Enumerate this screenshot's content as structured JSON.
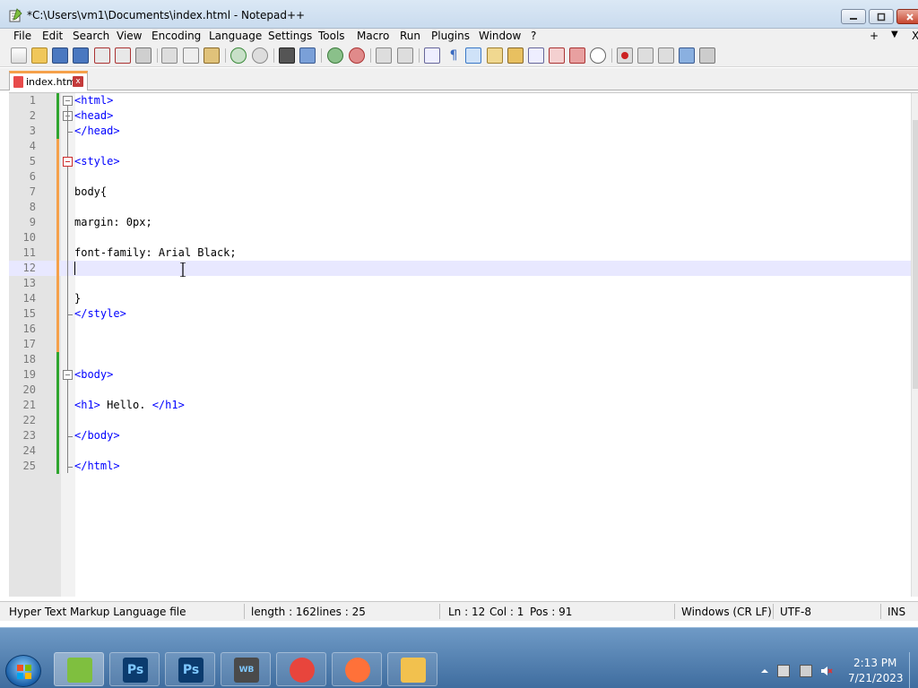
{
  "window": {
    "title": "*C:\\Users\\vm1\\Documents\\index.html - Notepad++"
  },
  "menu": {
    "items": [
      "File",
      "Edit",
      "Search",
      "View",
      "Encoding",
      "Language",
      "Settings",
      "Tools",
      "Macro",
      "Run",
      "Plugins",
      "Window",
      "?"
    ],
    "right_plus": "+",
    "right_down": "▼",
    "right_close": "X"
  },
  "toolbar": {
    "icons": [
      "new-file-icon",
      "open-file-icon",
      "save-icon",
      "save-all-icon",
      "close-icon",
      "close-all-icon",
      "print-icon",
      "cut-icon",
      "copy-icon",
      "paste-icon",
      "undo-icon",
      "redo-icon",
      "find-icon",
      "replace-icon",
      "zoom-in-icon",
      "zoom-out-icon",
      "sync-vertical-icon",
      "sync-horizontal-icon",
      "word-wrap-icon",
      "show-all-chars-icon",
      "indent-guide-icon",
      "udl-icon",
      "doc-map-icon",
      "function-list-icon",
      "folder-workspace-icon",
      "monitor-icon",
      "record-macro-icon",
      "stop-macro-icon",
      "play-macro-icon",
      "run-macro-multiple-icon",
      "save-macro-icon"
    ]
  },
  "tab": {
    "label": "index.html",
    "close": "x"
  },
  "editor": {
    "lines": [
      {
        "n": "1",
        "text": "<html>",
        "type": "tag"
      },
      {
        "n": "2",
        "text": "<head>",
        "type": "tag"
      },
      {
        "n": "3",
        "text": "</head>",
        "type": "tag"
      },
      {
        "n": "4",
        "text": "",
        "type": "plain"
      },
      {
        "n": "5",
        "text": "<style>",
        "type": "tag"
      },
      {
        "n": "6",
        "text": "",
        "type": "plain"
      },
      {
        "n": "7",
        "text": "body{",
        "type": "plain"
      },
      {
        "n": "8",
        "text": "",
        "type": "plain"
      },
      {
        "n": "9",
        "text": "margin: 0px;",
        "type": "plain"
      },
      {
        "n": "10",
        "text": "",
        "type": "plain"
      },
      {
        "n": "11",
        "text": "font-family: Arial Black;",
        "type": "plain"
      },
      {
        "n": "12",
        "text": "",
        "type": "plain"
      },
      {
        "n": "13",
        "text": "",
        "type": "plain"
      },
      {
        "n": "14",
        "text": "}",
        "type": "plain"
      },
      {
        "n": "15",
        "text": "</style>",
        "type": "tag"
      },
      {
        "n": "16",
        "text": "",
        "type": "plain"
      },
      {
        "n": "17",
        "text": "",
        "type": "plain"
      },
      {
        "n": "18",
        "text": "",
        "type": "plain"
      },
      {
        "n": "19",
        "text": "<body>",
        "type": "tag"
      },
      {
        "n": "20",
        "text": "",
        "type": "plain"
      },
      {
        "n": "21",
        "text": "<h1> Hello. </h1>",
        "type": "h1"
      },
      {
        "n": "22",
        "text": "",
        "type": "plain"
      },
      {
        "n": "23",
        "text": "</body>",
        "type": "tag"
      },
      {
        "n": "24",
        "text": "",
        "type": "plain"
      },
      {
        "n": "25",
        "text": "</html>",
        "type": "tag"
      }
    ],
    "current_line": "12"
  },
  "status": {
    "file_type": "Hyper Text Markup Language file",
    "length": "length : 162",
    "lines": "lines : 25",
    "ln": "Ln : 12",
    "col": "Col : 1",
    "pos": "Pos : 91",
    "eol": "Windows (CR LF)",
    "encoding": "UTF-8",
    "mode": "INS"
  },
  "taskbar": {
    "apps": [
      {
        "name": "notepadpp-task-button",
        "label": "",
        "color": "#7fbf3f",
        "active": true
      },
      {
        "name": "photoshop-task-button",
        "label": "Ps",
        "color": "#0b3b6e",
        "active": false
      },
      {
        "name": "photoshop-2-task-button",
        "label": "Ps",
        "color": "#0b3b6e",
        "active": false
      },
      {
        "name": "workbench-task-button",
        "label": "WB 12",
        "color": "#4a4a4a",
        "active": false
      },
      {
        "name": "chrome-task-button",
        "label": "",
        "color": "#e8453c",
        "active": false
      },
      {
        "name": "firefox-task-button",
        "label": "",
        "color": "#ff7139",
        "active": false
      },
      {
        "name": "explorer-task-button",
        "label": "",
        "color": "#f2c14e",
        "active": false
      }
    ],
    "time": "2:13 PM",
    "date": "7/21/2023"
  }
}
